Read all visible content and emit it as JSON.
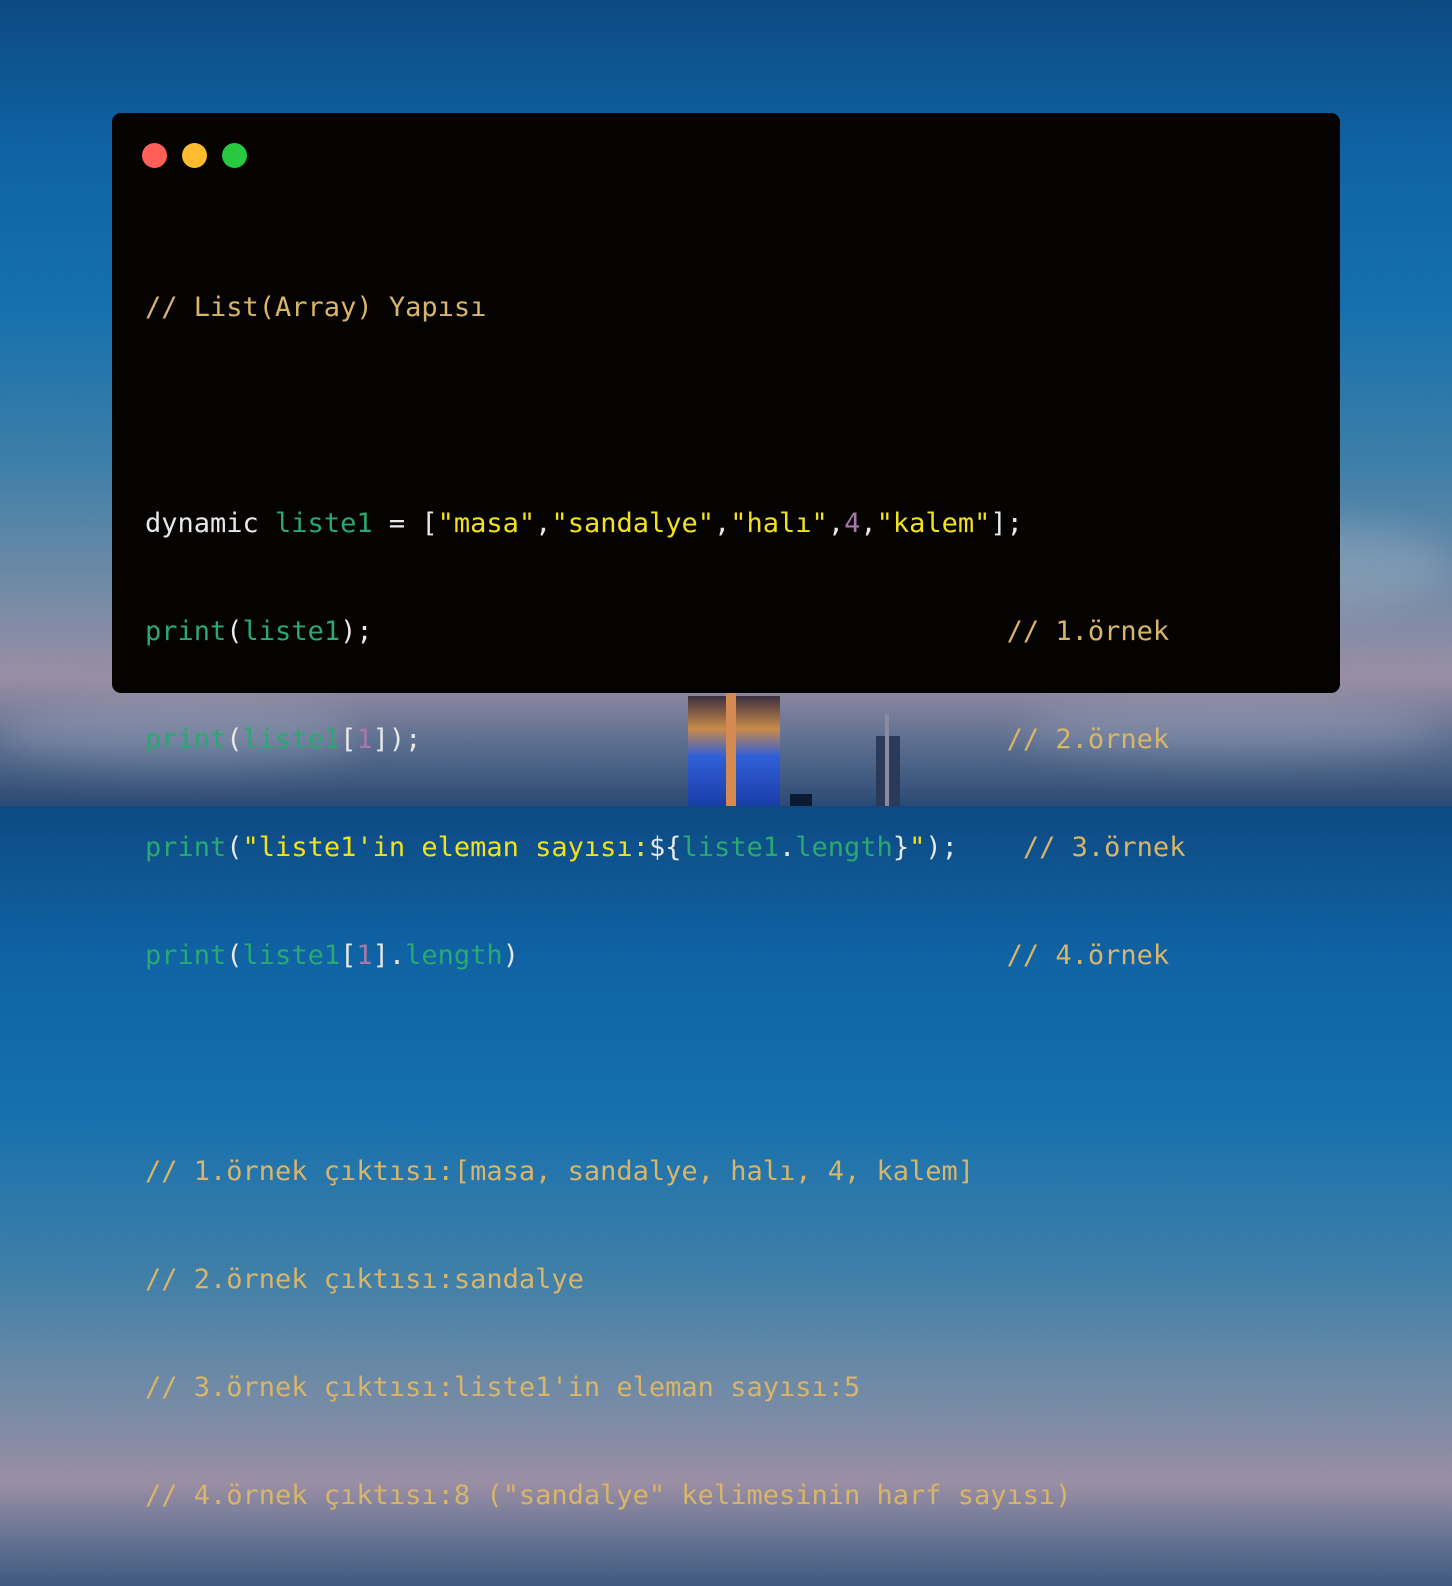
{
  "colors": {
    "close": "#ff5f57",
    "minimize": "#febc2e",
    "maximize": "#28c840",
    "panel": "#050302",
    "comment": "#d9b56a",
    "identifier": "#2aa872",
    "string": "#f2e21a",
    "number": "#a67aa8",
    "plain": "#e8e8e8"
  },
  "code": {
    "title_comment": "// List(Array) Yapısı",
    "decl": {
      "kw": "dynamic ",
      "var": "liste1",
      "eq": " = [",
      "s1": "\"masa\"",
      "c1": ",",
      "s2": "\"sandalye\"",
      "c2": ",",
      "s3": "\"halı\"",
      "c3": ",",
      "n1": "4",
      "c4": ",",
      "s4": "\"kalem\"",
      "end": "];"
    },
    "l1": {
      "fn": "print",
      "p1": "(",
      "arg": "liste1",
      "p2": ");",
      "pad": "                                       ",
      "cm": "// 1.örnek"
    },
    "l2": {
      "fn": "print",
      "p1": "(",
      "arg": "liste1",
      "b1": "[",
      "idx": "1",
      "b2": "]);",
      "pad": "                                    ",
      "cm": "// 2.örnek"
    },
    "l3": {
      "fn": "print",
      "p1": "(",
      "s": "\"liste1'in eleman sayısı:",
      "d": "${",
      "arg": "liste1",
      "dot": ".",
      "prop": "length",
      "cl": "}",
      "q": "\"",
      "p2": ");",
      "pad": "    ",
      "cm": "// 3.örnek"
    },
    "l4": {
      "fn": "print",
      "p1": "(",
      "arg": "liste1",
      "b1": "[",
      "idx": "1",
      "b2": "].",
      "prop": "length",
      "p2": ")",
      "pad": "                              ",
      "cm": "// 4.örnek"
    },
    "out1": "// 1.örnek çıktısı:[masa, sandalye, halı, 4, kalem]",
    "out2": "// 2.örnek çıktısı:sandalye",
    "out3": "// 3.örnek çıktısı:liste1'in eleman sayısı:5",
    "out4": "// 4.örnek çıktısı:8 (\"sandalye\" kelimesinin harf sayısı)"
  }
}
